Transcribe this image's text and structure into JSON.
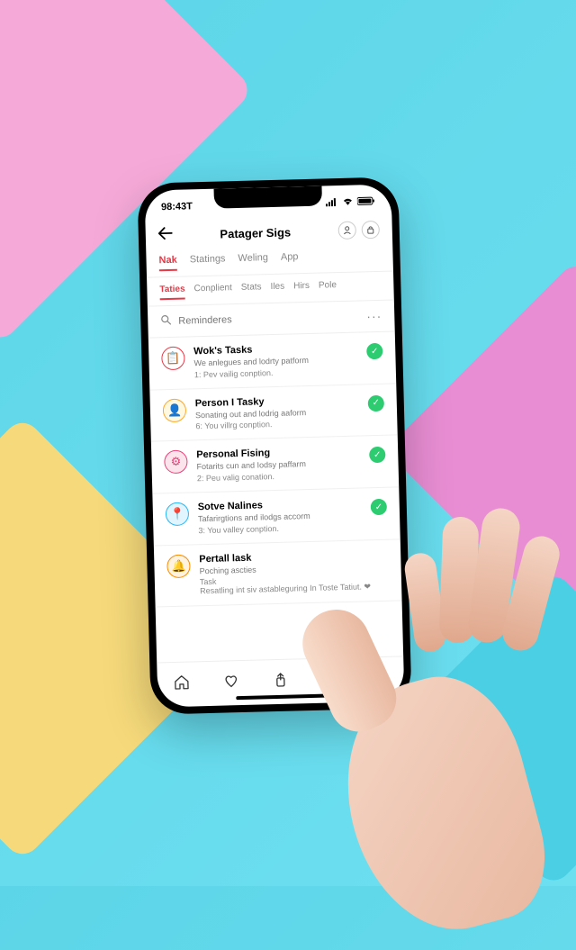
{
  "status": {
    "time": "98:43T"
  },
  "header": {
    "title": "Patager Sigs"
  },
  "tabs": [
    {
      "label": "Nak",
      "active": true
    },
    {
      "label": "Statings",
      "active": false
    },
    {
      "label": "Weling",
      "active": false
    },
    {
      "label": "App",
      "active": false
    }
  ],
  "subtabs": [
    {
      "label": "Taties",
      "active": true
    },
    {
      "label": "Conplient",
      "active": false
    },
    {
      "label": "Stats",
      "active": false
    },
    {
      "label": "Iles",
      "active": false
    },
    {
      "label": "Hirs",
      "active": false
    },
    {
      "label": "Pole",
      "active": false
    }
  ],
  "search": {
    "placeholder": "Reminderes"
  },
  "items": [
    {
      "title": "Wok's Tasks",
      "desc": "We anlegues and lodrty patform",
      "sub": "1: Pev vailig conption.",
      "icon_bg": "#fff",
      "icon_color": "#e63946",
      "icon": "📋"
    },
    {
      "title": "Person I Tasky",
      "desc": "Sonating out and lodrig aaform",
      "sub": "6: You villrg conption.",
      "icon_bg": "#fff8e1",
      "icon_color": "#ffa726",
      "icon": "👤"
    },
    {
      "title": "Personal Fising",
      "desc": "Fotarits cun and Iodsy paffarm",
      "sub": "2: Peu valig conation.",
      "icon_bg": "#fce4ec",
      "icon_color": "#ec407a",
      "icon": "⚙"
    },
    {
      "title": "Sotve Nalines",
      "desc": "Tafarirgtions and ilodgs accorm",
      "sub": "3: You valley conption.",
      "icon_bg": "#e1f5fe",
      "icon_color": "#29b6f6",
      "icon": "📍"
    },
    {
      "title": "Pertall lask",
      "desc": "Poching ascties",
      "sub": "Task\nResatling int siv astableguring In Toste Tatiut. ❤",
      "icon_bg": "#fff3e0",
      "icon_color": "#fb8c00",
      "icon": "🔔",
      "no_check": true
    }
  ]
}
